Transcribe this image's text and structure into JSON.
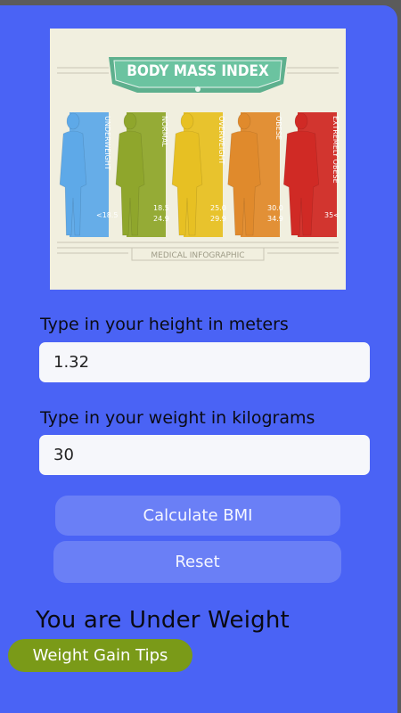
{
  "hero": {
    "title": "BODY MASS INDEX",
    "footer": "MEDICAL INFOGRAPHIC",
    "categories": [
      {
        "name": "UNDERWEIGHT",
        "range_top": "",
        "range_bottom": "<18.5",
        "color": "#5ea9e8"
      },
      {
        "name": "NORMAL",
        "range_top": "18.5",
        "range_bottom": "24.9",
        "color": "#8fa62c"
      },
      {
        "name": "OVERWEIGHT",
        "range_top": "25.0",
        "range_bottom": "29.9",
        "color": "#e7c023"
      },
      {
        "name": "OBESE",
        "range_top": "30.0",
        "range_bottom": "34.9",
        "color": "#e08a2c"
      },
      {
        "name": "EXTREMELY OBESE",
        "range_top": "",
        "range_bottom": "35<",
        "color": "#d02a25"
      }
    ]
  },
  "form": {
    "height_label": "Type in your height in meters",
    "height_value": "1.32",
    "weight_label": "Type in your weight in kilograms",
    "weight_value": "30",
    "calculate_label": "Calculate BMI",
    "reset_label": "Reset"
  },
  "result": {
    "text": "You are Under Weight",
    "tips_label": "Weight Gain Tips"
  },
  "colors": {
    "background": "#4a63f5",
    "tips_button": "#7a9a18"
  }
}
